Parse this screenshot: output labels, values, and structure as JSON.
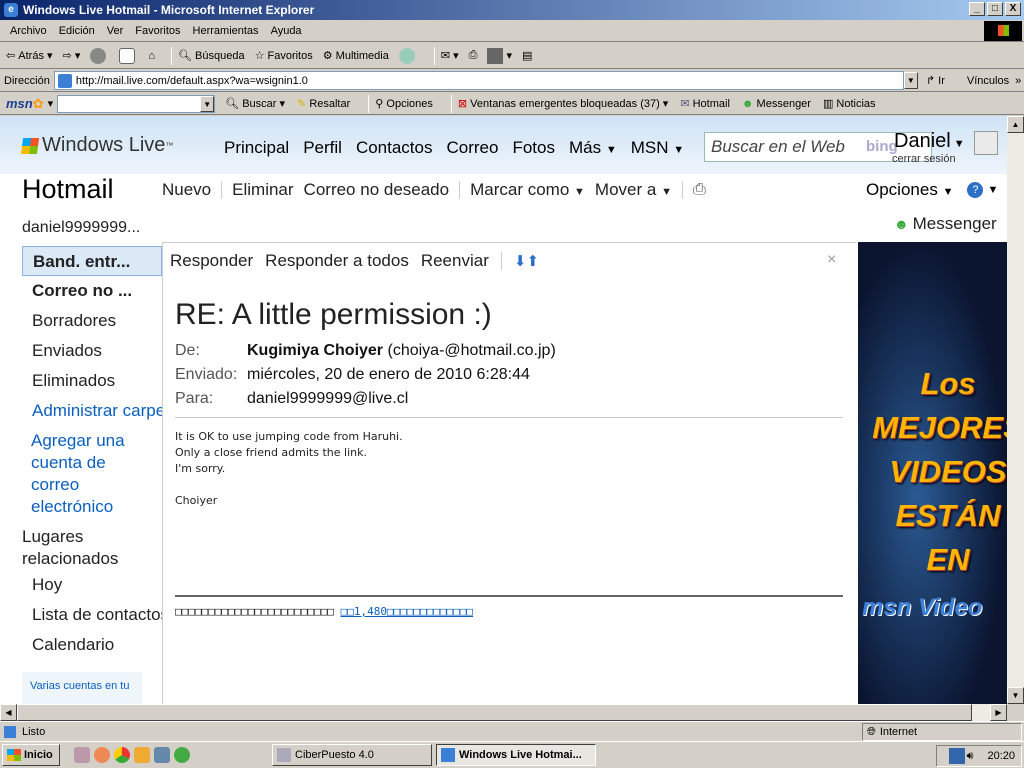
{
  "window": {
    "title": "Windows Live Hotmail - Microsoft Internet Explorer",
    "buttons": [
      "_",
      "□",
      "X"
    ]
  },
  "menu": [
    "Archivo",
    "Edición",
    "Ver",
    "Favoritos",
    "Herramientas",
    "Ayuda"
  ],
  "toolbar": {
    "back": "Atrás",
    "search": "Búsqueda",
    "favorites": "Favoritos",
    "multimedia": "Multimedia"
  },
  "address": {
    "label": "Dirección",
    "url": "http://mail.live.com/default.aspx?wa=wsignin1.0",
    "go": "Ir",
    "links": "Vínculos"
  },
  "msnbar": {
    "logo": "msn",
    "search_value": "",
    "search": "Buscar",
    "highlight": "Resaltar",
    "options": "Opciones",
    "popups": "Ventanas emergentes bloqueadas (37)",
    "hotmail": "Hotmail",
    "messenger": "Messenger",
    "news": "Noticias"
  },
  "live": {
    "logo": "Windows Live",
    "nav": [
      "Principal",
      "Perfil",
      "Contactos",
      "Correo",
      "Fotos",
      "Más",
      "MSN"
    ],
    "search_placeholder": "Buscar en el Web",
    "bing": "bing",
    "user": "Daniel",
    "signout": "cerrar sesión"
  },
  "hotmail": {
    "title": "Hotmail",
    "commands": [
      "Nuevo",
      "Eliminar",
      "Correo no deseado",
      "Marcar como",
      "Mover a"
    ],
    "options": "Opciones",
    "account": "daniel9999999...",
    "messenger": "Messenger"
  },
  "leftnav": {
    "folders": [
      {
        "label": "Band. entr...",
        "state": "selected"
      },
      {
        "label": "Correo no ...",
        "state": "bold"
      },
      {
        "label": "Borradores",
        "state": ""
      },
      {
        "label": "Enviados",
        "state": ""
      },
      {
        "label": "Eliminados",
        "state": ""
      },
      {
        "label": "Administrar carpetas",
        "state": "link"
      }
    ],
    "add_account": [
      "Agregar una",
      "cuenta de",
      "correo",
      "electrónico"
    ],
    "related_title": [
      "Lugares",
      "relacionados"
    ],
    "related": [
      "Hoy",
      "Lista de contactos",
      "Calendario"
    ],
    "promo": "Varias cuentas en tu"
  },
  "message": {
    "actions": [
      "Responder",
      "Responder a todos",
      "Reenviar"
    ],
    "close": "×",
    "subject": "RE: A little permission :)",
    "from_label": "De:",
    "from_name": "Kugimiya Choiyer",
    "from_email": "(choiya-@hotmail.co.jp)",
    "sent_label": "Enviado:",
    "sent": "miércoles, 20 de enero de 2010 6:28:44",
    "to_label": "Para:",
    "to": "daniel9999999@live.cl",
    "body": "It is OK to use jumping code from Haruhi.\nOnly a close friend admits the link.\nI'm sorry.\n\nChoiyer",
    "footer_text": "□□□□□□□□□□□□□□□□□□□□□□□□",
    "footer_link": "□□1,480□□□□□□□□□□□□□"
  },
  "ad": {
    "lines": [
      "Los",
      "MEJORES",
      "VIDEOS",
      "ESTÁN",
      "EN"
    ],
    "brand": "msn Video"
  },
  "status": {
    "text": "Listo",
    "zone": "Internet"
  },
  "taskbar": {
    "start": "Inicio",
    "tasks": [
      "CiberPuesto 4.0",
      "Windows Live Hotmai..."
    ],
    "clock": "20:20"
  },
  "colors": {
    "link": "#0b5fbf",
    "titlebar": "#0a246a",
    "selected_folder": "#dbe8f6",
    "ad_text": "#ffb400"
  }
}
